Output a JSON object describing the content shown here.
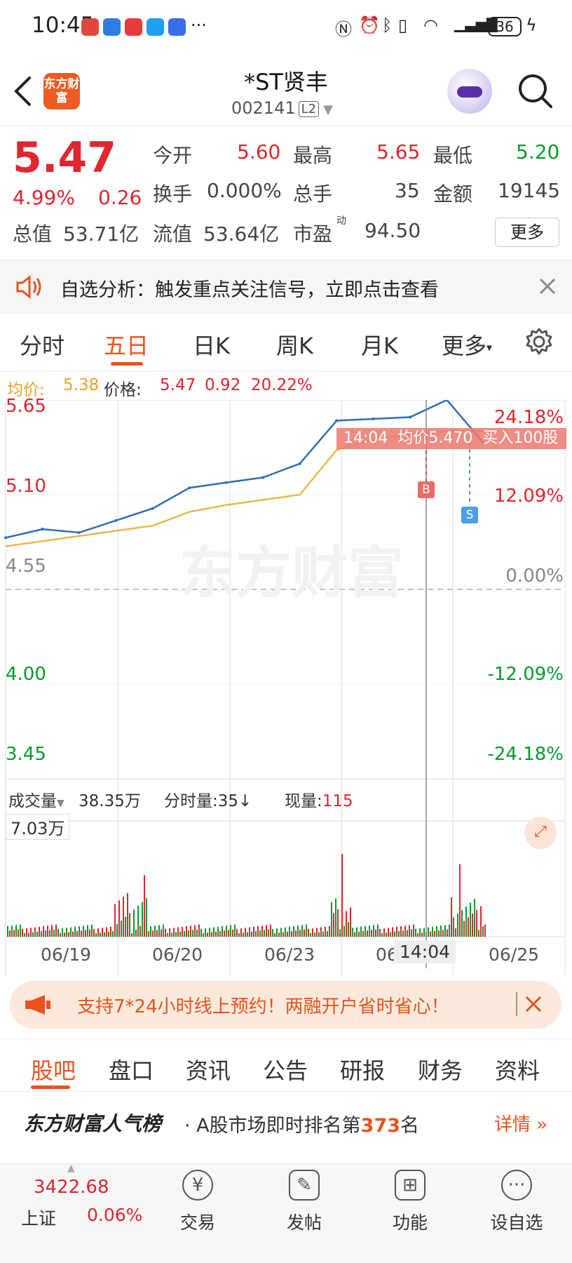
{
  "status_bar": {
    "time": "10:45",
    "battery": "36"
  },
  "header": {
    "back_icon": "back-arrow-icon",
    "logo_text": "东方财富",
    "title": "*ST贤丰",
    "code": "002141",
    "level": "L2"
  },
  "quote": {
    "price": "5.47",
    "change_pct": "4.99%",
    "change": "0.26",
    "open_label": "今开",
    "open": "5.60",
    "high_label": "最高",
    "high": "5.65",
    "low_label": "最低",
    "low": "5.20",
    "turnover_label": "换手",
    "turnover": "0.000%",
    "volume_label": "总手",
    "volume": "35",
    "amount_label": "金额",
    "amount": "19145",
    "mktcap_label": "总值",
    "mktcap": "53.71亿",
    "float_label": "流值",
    "float": "53.64亿",
    "pe_label": "市盈",
    "pe_sup": "动",
    "pe": "94.50",
    "more": "更多"
  },
  "notice": {
    "text": "自选分析：触发重点关注信号，立即点击查看"
  },
  "chart_tabs": [
    {
      "label": "分时"
    },
    {
      "label": "五日"
    },
    {
      "label": "日K"
    },
    {
      "label": "周K"
    },
    {
      "label": "月K"
    },
    {
      "label": "更多"
    }
  ],
  "legend": {
    "avg_label": "均价:",
    "avg": "5.38",
    "price_label": "价格:",
    "price": "5.47",
    "change": "0.92",
    "pct": "20.22%"
  },
  "chart_data": {
    "type": "line",
    "title": "",
    "x": [
      "06/19",
      "06/20",
      "06/23",
      "06/24",
      "06/25"
    ],
    "series": [
      {
        "name": "价格",
        "values": [
          4.85,
          4.9,
          4.88,
          4.95,
          5.02,
          5.14,
          5.17,
          5.2,
          5.28,
          5.53,
          5.54,
          5.55,
          5.65,
          5.4
        ]
      },
      {
        "name": "均价",
        "values": [
          4.8,
          4.83,
          4.86,
          4.89,
          4.92,
          5.0,
          5.04,
          5.07,
          5.1,
          5.36,
          5.42,
          5.45,
          5.47,
          5.47
        ]
      }
    ],
    "ylim": [
      3.45,
      5.65
    ],
    "y_ticks": [
      "5.65",
      "5.10",
      "4.55",
      "4.00",
      "3.45"
    ],
    "pct_ticks": [
      "24.18%",
      "12.09%",
      "0.00%",
      "-12.09%",
      "-24.18%"
    ],
    "crosshair": {
      "time": "14:04",
      "avg": "均价5.470",
      "trade": "买入100股"
    },
    "markers": [
      "B",
      "S"
    ],
    "grid": true,
    "watermark": "东方财富"
  },
  "volume": {
    "label": "成交量",
    "total": "38.35万",
    "minute_label": "分时量:35↓",
    "now_label": "现量:",
    "now": "115",
    "max": "7.03万"
  },
  "x_axis": {
    "d1": "06/19",
    "d2": "06/20",
    "d3": "06/23",
    "d4": "06",
    "time": "14:04",
    "d5": "06/25"
  },
  "banner": {
    "text": "支持7*24小时线上预约！两融开户省时省心！"
  },
  "subnav": [
    {
      "label": "股吧"
    },
    {
      "label": "盘口"
    },
    {
      "label": "资讯"
    },
    {
      "label": "公告"
    },
    {
      "label": "研报"
    },
    {
      "label": "财务"
    },
    {
      "label": "资料"
    }
  ],
  "rank": {
    "brand": "东方财富人气榜",
    "text_a": "A股市场即时排名第",
    "rank": "373",
    "text_b": "名",
    "detail": "详情"
  },
  "bottom": {
    "index_value": "3422.68",
    "index_name": "上证",
    "index_pct": "0.06%",
    "items": [
      {
        "label": "交易"
      },
      {
        "label": "发帖"
      },
      {
        "label": "功能"
      },
      {
        "label": "设自选"
      }
    ]
  },
  "colors": {
    "accent": "#e8541e",
    "up": "#e0262e",
    "down": "#0a9a2c",
    "price_line": "#2f6fb5",
    "avg_line": "#e9b84a"
  }
}
